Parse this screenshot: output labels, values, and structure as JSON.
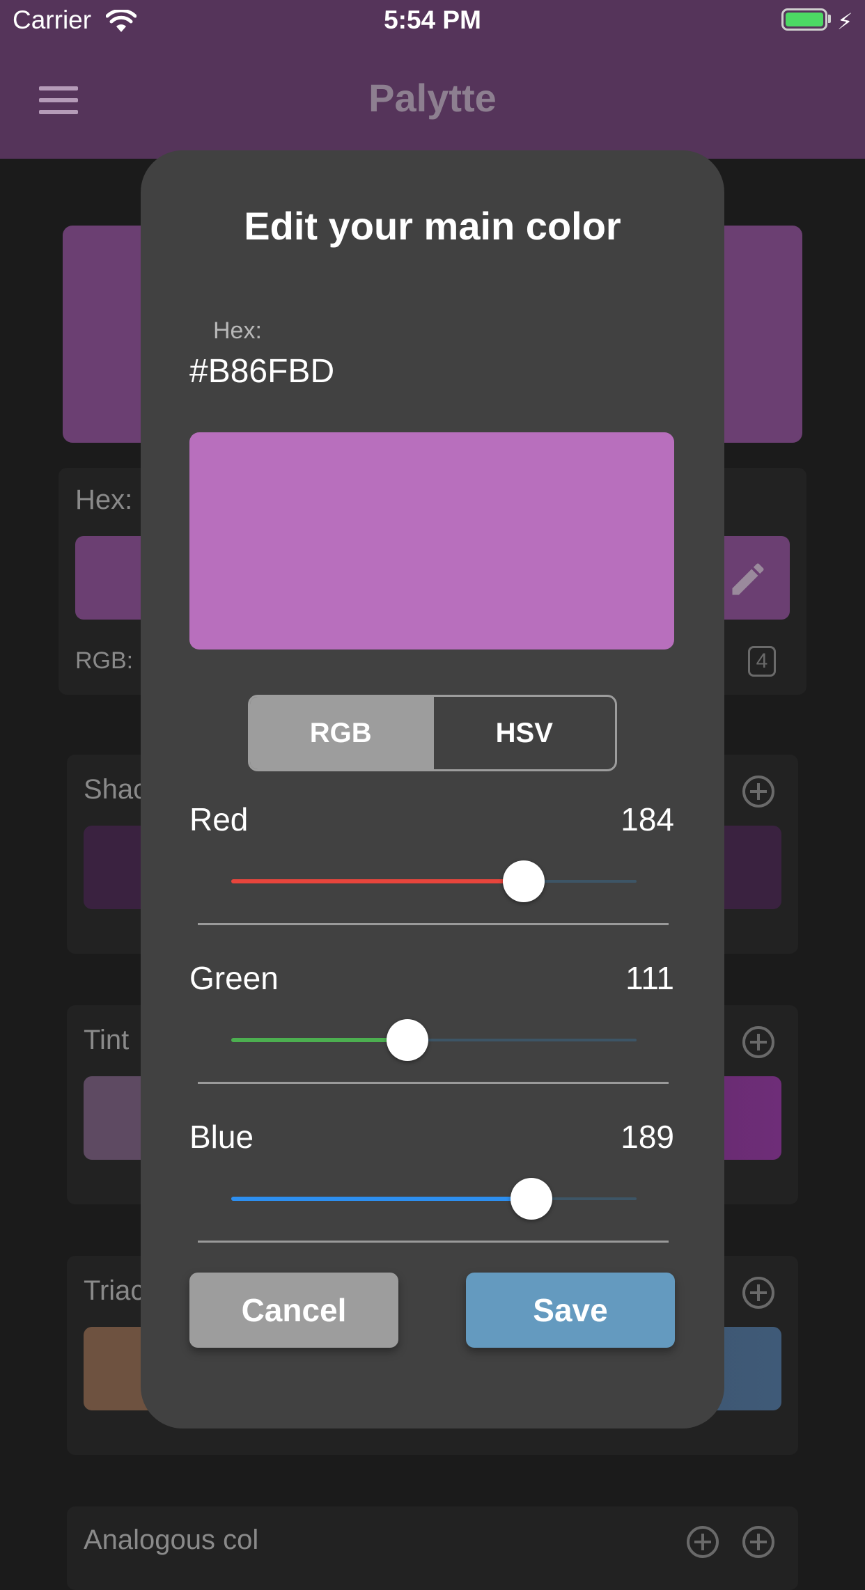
{
  "status_bar": {
    "carrier": "Carrier",
    "time": "5:54 PM"
  },
  "nav": {
    "title": "Palytte"
  },
  "background": {
    "hex_label": "Hex:",
    "rgb_label": "RGB:",
    "rgb_value_fragment": "4",
    "sections": [
      {
        "label": "Shac"
      },
      {
        "label": "Tint"
      },
      {
        "label": "Triac"
      },
      {
        "label": "Analogous col"
      }
    ]
  },
  "modal": {
    "title": "Edit your main color",
    "hex_label": "Hex:",
    "hex_value": "#B86FBD",
    "preview_color": "#b86fbd",
    "tabs": [
      {
        "label": "RGB",
        "active": true
      },
      {
        "label": "HSV",
        "active": false
      }
    ],
    "channels": [
      {
        "label": "Red",
        "value": "184",
        "fraction": 0.7216,
        "color": "#e8453c"
      },
      {
        "label": "Green",
        "value": "111",
        "fraction": 0.4353,
        "color": "#4caf50"
      },
      {
        "label": "Blue",
        "value": "189",
        "fraction": 0.7412,
        "color": "#2d8ff0"
      }
    ],
    "cancel_label": "Cancel",
    "save_label": "Save"
  },
  "colors": {
    "nav_bg": "#55345a",
    "accent_save": "#649abf",
    "neutral_button": "#9d9d9d"
  }
}
